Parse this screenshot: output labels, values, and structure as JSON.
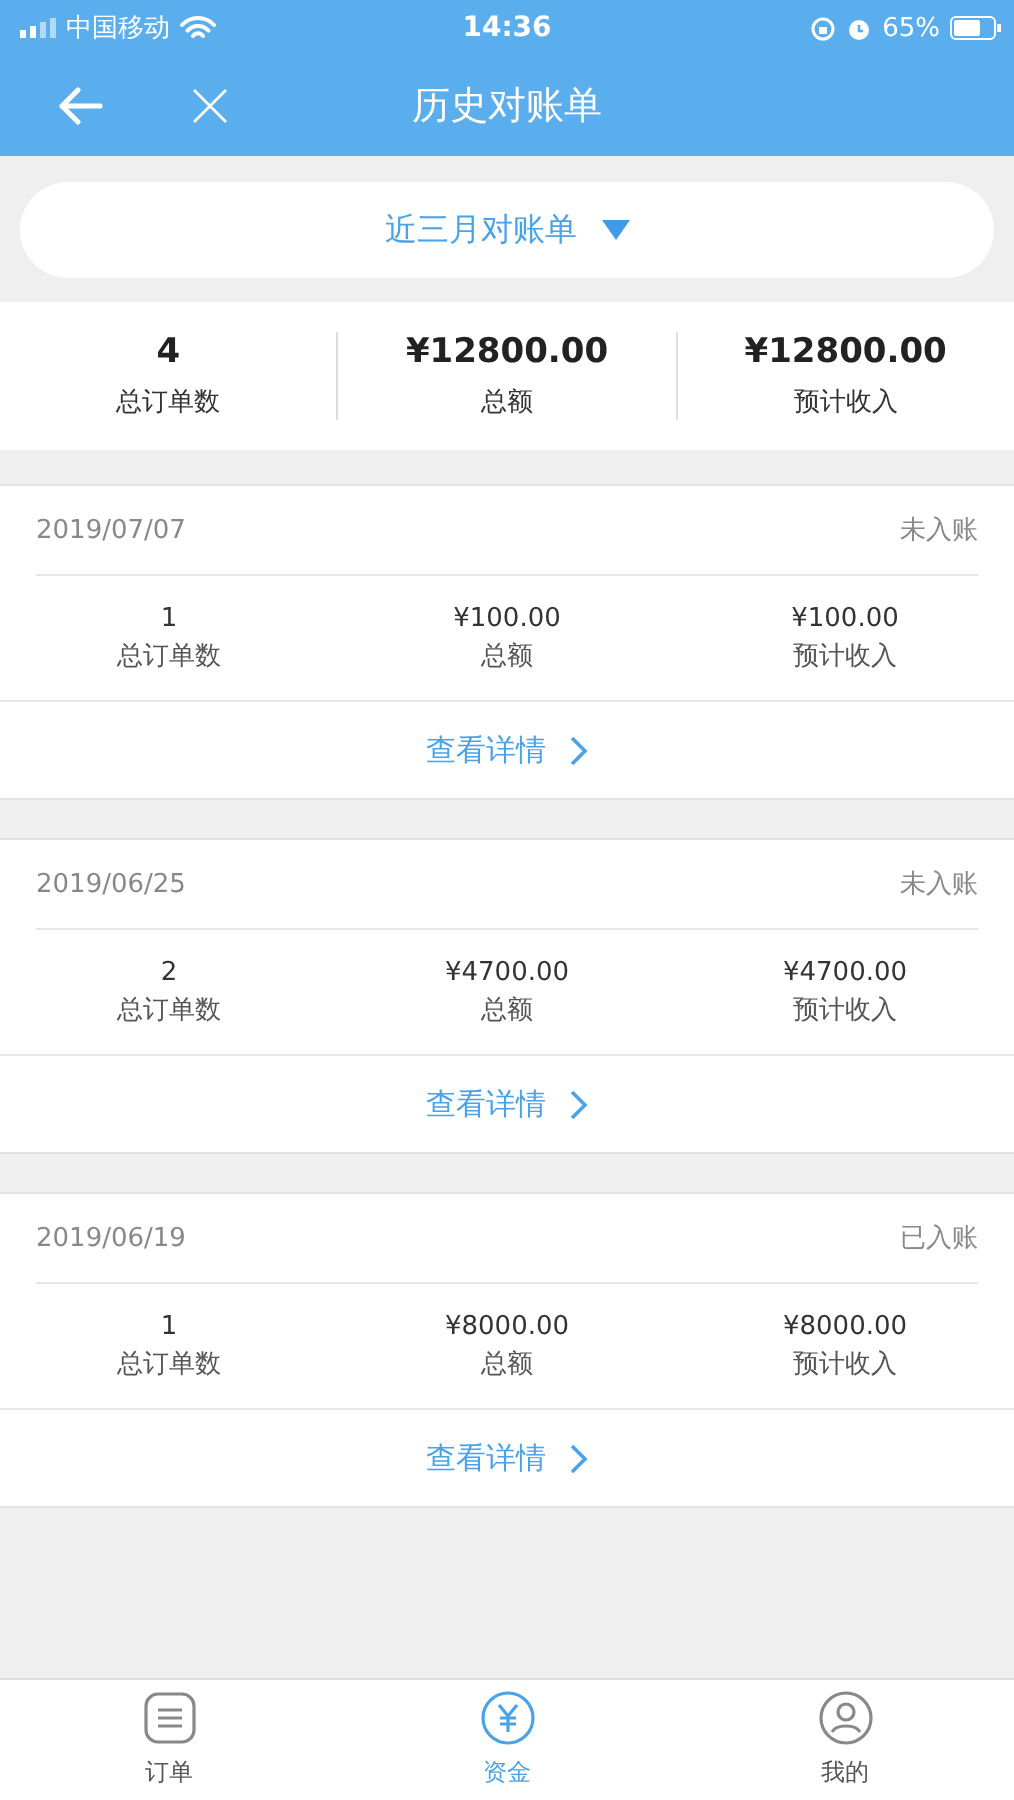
{
  "status_bar": {
    "carrier": "中国移动",
    "time": "14:36",
    "battery": "65%"
  },
  "header": {
    "title": "历史对账单"
  },
  "filter": {
    "label": "近三月对账单"
  },
  "summary": [
    {
      "value": "4",
      "label": "总订单数"
    },
    {
      "value": "¥12800.00",
      "label": "总额"
    },
    {
      "value": "¥12800.00",
      "label": "预计收入"
    }
  ],
  "statements": [
    {
      "date": "2019/07/07",
      "status": "未入账",
      "stats": [
        {
          "value": "1",
          "label": "总订单数"
        },
        {
          "value": "¥100.00",
          "label": "总额"
        },
        {
          "value": "¥100.00",
          "label": "预计收入"
        }
      ],
      "link": "查看详情"
    },
    {
      "date": "2019/06/25",
      "status": "未入账",
      "stats": [
        {
          "value": "2",
          "label": "总订单数"
        },
        {
          "value": "¥4700.00",
          "label": "总额"
        },
        {
          "value": "¥4700.00",
          "label": "预计收入"
        }
      ],
      "link": "查看详情"
    },
    {
      "date": "2019/06/19",
      "status": "已入账",
      "stats": [
        {
          "value": "1",
          "label": "总订单数"
        },
        {
          "value": "¥8000.00",
          "label": "总额"
        },
        {
          "value": "¥8000.00",
          "label": "预计收入"
        }
      ],
      "link": "查看详情"
    }
  ],
  "tab_bar": [
    {
      "label": "订单",
      "selected": false
    },
    {
      "label": "资金",
      "selected": true
    },
    {
      "label": "我的",
      "selected": false
    }
  ]
}
